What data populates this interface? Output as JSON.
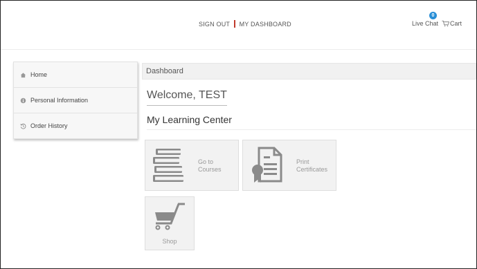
{
  "header": {
    "sign_out": "SIGN OUT",
    "my_dashboard": "MY DASHBOARD",
    "live_chat": "Live Chat",
    "chat_count": "0",
    "cart": "Cart"
  },
  "sidebar": {
    "items": [
      {
        "label": "Home",
        "icon": "home-icon"
      },
      {
        "label": "Personal Information",
        "icon": "info-icon"
      },
      {
        "label": "Order History",
        "icon": "history-icon"
      }
    ]
  },
  "main": {
    "breadcrumb": "Dashboard",
    "welcome": "Welcome, TEST",
    "section_title": "My Learning Center",
    "tiles": [
      {
        "line1": "Go to",
        "line2": "Courses",
        "icon": "books-icon"
      },
      {
        "line1": "Print",
        "line2": "Certificates",
        "icon": "certificate-icon"
      },
      {
        "line1": "Shop",
        "icon": "cart-icon"
      }
    ]
  },
  "colors": {
    "accent_separator": "#c0392b",
    "badge": "#2a8fd6",
    "tile_bg": "#f2f2f2",
    "icon_gray": "#8a8a8a"
  }
}
